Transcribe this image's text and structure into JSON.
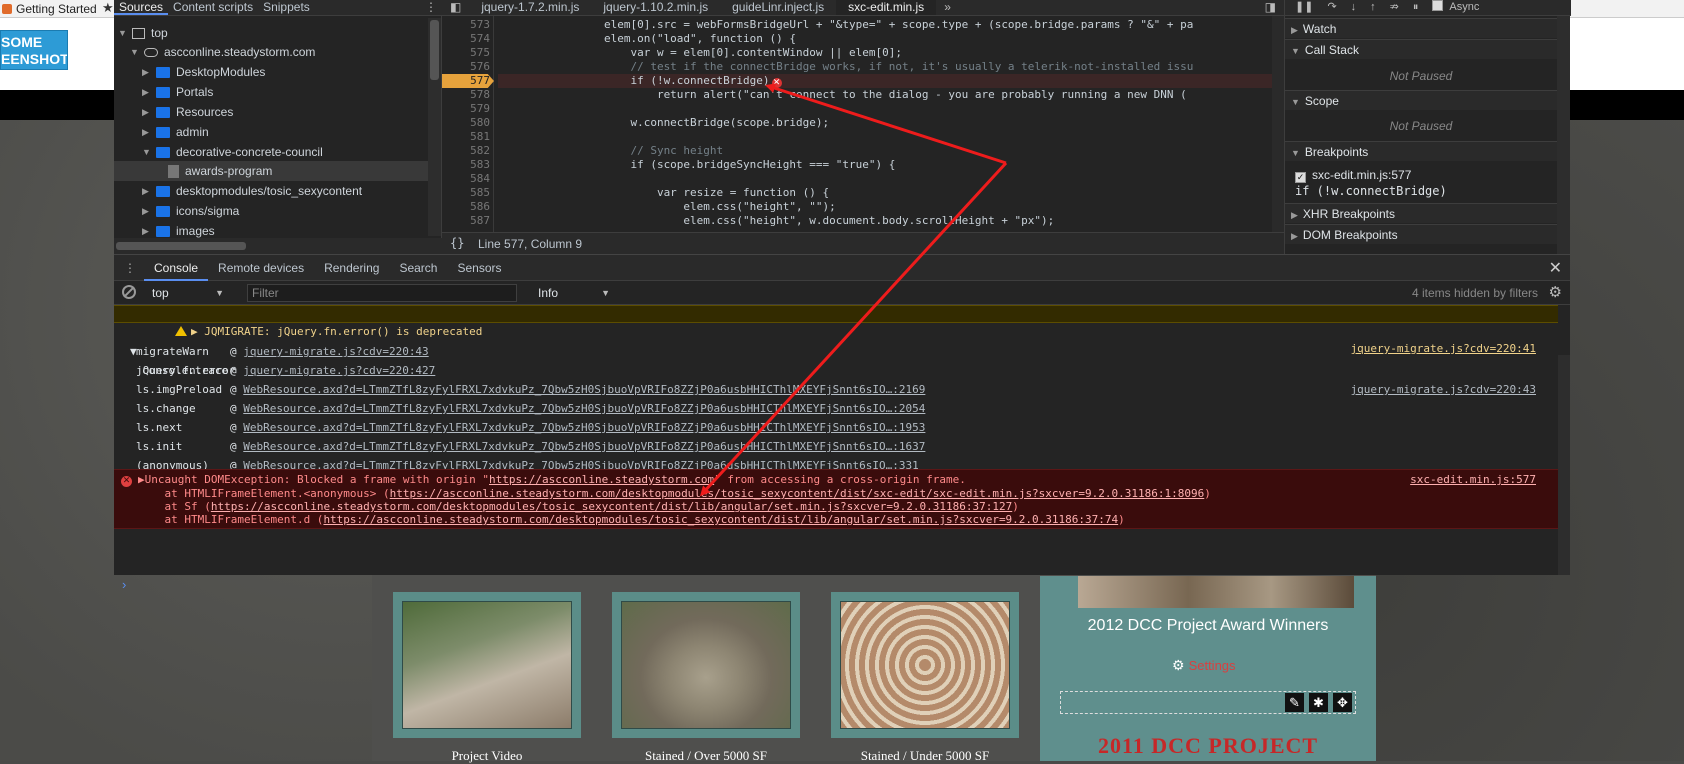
{
  "bookmarks": {
    "getting_started": "Getting Started"
  },
  "site": {
    "header_button": "SOME\nEENSHOT",
    "thumbs": [
      {
        "caption": "Project Video"
      },
      {
        "caption": "Stained / Over 5000 SF"
      },
      {
        "caption": "Stained / Under 5000 SF"
      }
    ],
    "award_title": "2012 DCC Project Award Winners",
    "settings_link": "Settings",
    "project_heading": "2011 DCC PROJECT"
  },
  "navigator": {
    "tabs": [
      "Sources",
      "Content scripts",
      "Snippets"
    ],
    "tree": [
      {
        "label": "top",
        "icon": "frame-icon"
      },
      {
        "label": "ascconline.steadystorm.com",
        "icon": "cloud-icon"
      },
      {
        "label": "DesktopModules",
        "icon": "folder-icon"
      },
      {
        "label": "Portals",
        "icon": "folder-icon"
      },
      {
        "label": "Resources",
        "icon": "folder-icon"
      },
      {
        "label": "admin",
        "icon": "folder-icon"
      },
      {
        "label": "decorative-concrete-council",
        "icon": "folder-icon"
      },
      {
        "label": "awards-program",
        "icon": "file-icon"
      },
      {
        "label": "desktopmodules/tosic_sexycontent",
        "icon": "folder-icon"
      },
      {
        "label": "icons/sigma",
        "icon": "folder-icon"
      },
      {
        "label": "images",
        "icon": "folder-icon"
      }
    ]
  },
  "editor": {
    "tabs": [
      "jquery-1.7.2.min.js",
      "jquery-1.10.2.min.js",
      "guideLinr.inject.js",
      "sxc-edit.min.js"
    ],
    "active_tab": "sxc-edit.min.js",
    "breakpoint_line": "577",
    "lines": [
      {
        "n": "573",
        "text": "                elem[0].src = webFormsBridgeUrl + \"&type=\" + scope.type + (scope.bridge.params ? \"&\" + pa"
      },
      {
        "n": "574",
        "text": "                elem.on(\"load\", function () {"
      },
      {
        "n": "575",
        "text": "                    var w = elem[0].contentWindow || elem[0];"
      },
      {
        "n": "576",
        "text": "                    // test if the connectBridge works, if not, it's usually a telerik-not-installed issu"
      },
      {
        "n": "577",
        "text": "                    if (!w.connectBridge)"
      },
      {
        "n": "578",
        "text": "                        return alert(\"can't connect to the dialog - you are probably running a new DNN ("
      },
      {
        "n": "579",
        "text": ""
      },
      {
        "n": "580",
        "text": "                    w.connectBridge(scope.bridge);"
      },
      {
        "n": "581",
        "text": ""
      },
      {
        "n": "582",
        "text": "                    // Sync height"
      },
      {
        "n": "583",
        "text": "                    if (scope.bridgeSyncHeight === \"true\") {"
      },
      {
        "n": "584",
        "text": ""
      },
      {
        "n": "585",
        "text": "                        var resize = function () {"
      },
      {
        "n": "586",
        "text": "                            elem.css(\"height\", \"\");"
      },
      {
        "n": "587",
        "text": "                            elem.css(\"height\", w.document.body.scrollHeight + \"px\");"
      }
    ],
    "status_braces": "{}",
    "status_position": "Line 577, Column 9"
  },
  "debugger": {
    "async_label": "Async",
    "panes": {
      "watch": "Watch",
      "call_stack": "Call Stack",
      "call_stack_state": "Not Paused",
      "scope": "Scope",
      "scope_state": "Not Paused",
      "breakpoints": "Breakpoints",
      "xhr": "XHR Breakpoints",
      "dom": "DOM Breakpoints"
    },
    "breakpoint_item": "sxc-edit.min.js:577",
    "breakpoint_code": "if (!w.connectBridge)"
  },
  "console": {
    "tabs": [
      "Console",
      "Remote devices",
      "Rendering",
      "Search",
      "Sensors"
    ],
    "context": "top",
    "filter_placeholder": "Filter",
    "level": "Info",
    "hidden_count": "4 items hidden by filters",
    "warning": {
      "text": "JQMIGRATE: jQuery.fn.error() is deprecated",
      "source": "jquery-migrate.js?cdv=220:41"
    },
    "trace": {
      "label": "console.trace",
      "source": "jquery-migrate.js?cdv=220:43",
      "frames": [
        {
          "fn": "migrateWarn",
          "link": "jquery-migrate.js?cdv=220:43"
        },
        {
          "fn": "jQuery.fn.error",
          "link": "jquery-migrate.js?cdv=220:427"
        },
        {
          "fn": "ls.imgPreload",
          "link": "WebResource.axd?d=LTmmZTfL8zyFylFRXL7xdvkuPz_7Qbw5zH0SjbuoVpVRIFo8ZZjP0a6usbHHICThlMXEYFjSnnt6sIO…:2169"
        },
        {
          "fn": "ls.change",
          "link": "WebResource.axd?d=LTmmZTfL8zyFylFRXL7xdvkuPz_7Qbw5zH0SjbuoVpVRIFo8ZZjP0a6usbHHICThlMXEYFjSnnt6sIO…:2054"
        },
        {
          "fn": "ls.next",
          "link": "WebResource.axd?d=LTmmZTfL8zyFylFRXL7xdvkuPz_7Qbw5zH0SjbuoVpVRIFo8ZZjP0a6usbHHICThlMXEYFjSnnt6sIO…:1953"
        },
        {
          "fn": "ls.init",
          "link": "WebResource.axd?d=LTmmZTfL8zyFylFRXL7xdvkuPz_7Qbw5zH0SjbuoVpVRIFo8ZZjP0a6usbHHICThlMXEYFjSnnt6sIO…:1637"
        },
        {
          "fn": "(anonymous)",
          "link": "WebResource.axd?d=LTmmZTfL8zyFylFRXL7xdvkuPz_7Qbw5zH0SjbuoVpVRIFo8ZZjP0a6usbHHICThlMXEYFjSnnt6sIO…:331"
        }
      ]
    },
    "error": {
      "line1_prefix": "Uncaught DOMException: Blocked a frame with origin \"",
      "line1_link": "https://ascconline.steadystorm.com",
      "line1_suffix": "\" from accessing a cross-origin frame.",
      "source": "sxc-edit.min.js:577",
      "stack": [
        {
          "prefix": "    at HTMLIFrameElement.<anonymous> (",
          "link": "https://ascconline.steadystorm.com/desktopmodules/tosic_sexycontent/dist/sxc-edit/sxc-edit.min.js?sxcver=9.2.0.31186:1:8096",
          "suffix": ")"
        },
        {
          "prefix": "    at Sf (",
          "link": "https://ascconline.steadystorm.com/desktopmodules/tosic_sexycontent/dist/lib/angular/set.min.js?sxcver=9.2.0.31186:37:127",
          "suffix": ")"
        },
        {
          "prefix": "    at HTMLIFrameElement.d (",
          "link": "https://ascconline.steadystorm.com/desktopmodules/tosic_sexycontent/dist/lib/angular/set.min.js?sxcver=9.2.0.31186:37:74",
          "suffix": ")"
        }
      ]
    },
    "prompt": "›"
  },
  "colors": {
    "arrow": "#ee1c1c",
    "breakpoint": "#e6a23c",
    "accent": "#5a8ef0"
  }
}
